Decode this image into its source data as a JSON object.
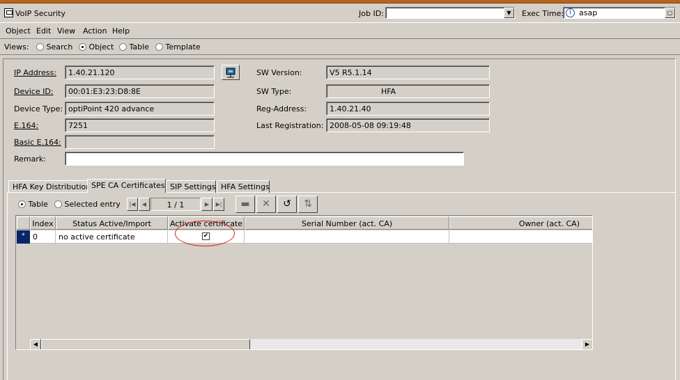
{
  "window": {
    "title": "VoIP Security"
  },
  "header": {
    "job_id_label": "Job ID:",
    "job_id_value": "",
    "exec_time_label": "Exec Time:",
    "exec_time_value": "asap"
  },
  "menu": [
    "Object",
    "Edit",
    "View",
    "Action",
    "Help"
  ],
  "views": {
    "label": "Views:",
    "options": [
      "Search",
      "Object",
      "Table",
      "Template"
    ],
    "selected": "Object"
  },
  "device": {
    "ip_label": "IP Address:",
    "ip_value": "1.40.21.120",
    "device_id_label": "Device ID:",
    "device_id_value": "00:01:E3:23:D8:8E",
    "device_type_label": "Device Type:",
    "device_type_value": "optiPoint 420 advance",
    "e164_label": "E.164:",
    "e164_value": "7251",
    "basic_e164_label": "Basic E.164:",
    "basic_e164_value": "",
    "remark_label": "Remark:",
    "remark_value": "",
    "sw_version_label": "SW Version:",
    "sw_version_value": "V5 R5.1.14",
    "sw_type_label": "SW Type:",
    "sw_type_value": "HFA",
    "reg_address_label": "Reg-Address:",
    "reg_address_value": "1.40.21.40",
    "last_reg_label": "Last Registration:",
    "last_reg_value": "2008-05-08 09:19:48"
  },
  "tabs": [
    "HFA Key Distribution",
    "SPE CA Certificates",
    "SIP Settings",
    "HFA Settings"
  ],
  "active_tab": "SPE CA Certificates",
  "display_mode": {
    "options": [
      "Table",
      "Selected entry"
    ],
    "selected": "Table"
  },
  "pager": {
    "text": "1 / 1"
  },
  "table": {
    "columns": [
      "Index",
      "Status Active/Import",
      "Activate certificate",
      "Serial Number (act. CA)",
      "Owner (act. CA)"
    ],
    "rows": [
      {
        "marker": "*",
        "index": "0",
        "status": "no active certificate",
        "activate": "✔",
        "serial": "",
        "owner": ""
      }
    ]
  }
}
